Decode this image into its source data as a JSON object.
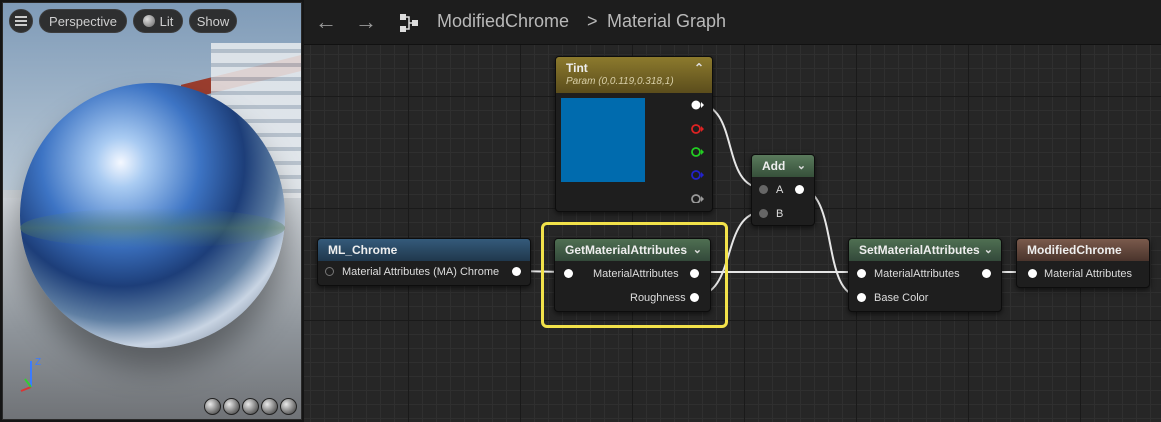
{
  "viewport": {
    "menu_icon": "hamburger-icon",
    "perspective_label": "Perspective",
    "lit_label": "Lit",
    "show_label": "Show",
    "axis": {
      "z": "Z"
    }
  },
  "toolbar": {
    "back_icon": "back-arrow-icon",
    "forward_icon": "forward-arrow-icon",
    "graph_icon": "material-graph-icon",
    "breadcrumb_asset": "ModifiedChrome",
    "breadcrumb_sep": ">",
    "breadcrumb_graph": "Material Graph"
  },
  "nodes": {
    "tint": {
      "title": "Tint",
      "subtitle": "Param (0,0.119,0.318,1)",
      "color": "#006bae"
    },
    "add": {
      "title": "Add",
      "pin_a": "A",
      "pin_b": "B"
    },
    "ml_chrome": {
      "title": "ML_Chrome",
      "output": "Material Attributes (MA) Chrome"
    },
    "get_attrs": {
      "title": "GetMaterialAttributes",
      "out_attrs": "MaterialAttributes",
      "out_roughness": "Roughness"
    },
    "set_attrs": {
      "title": "SetMaterialAttributes",
      "in_attrs": "MaterialAttributes",
      "in_base_color": "Base Color"
    },
    "result": {
      "title": "ModifiedChrome",
      "input": "Material Attributes"
    }
  },
  "colors": {
    "highlight": "#f2e24a",
    "param_header": "#7a6a2a",
    "function_header": "#3c5a3f",
    "input_header": "#2b4c66",
    "result_header": "#6a4c40"
  }
}
